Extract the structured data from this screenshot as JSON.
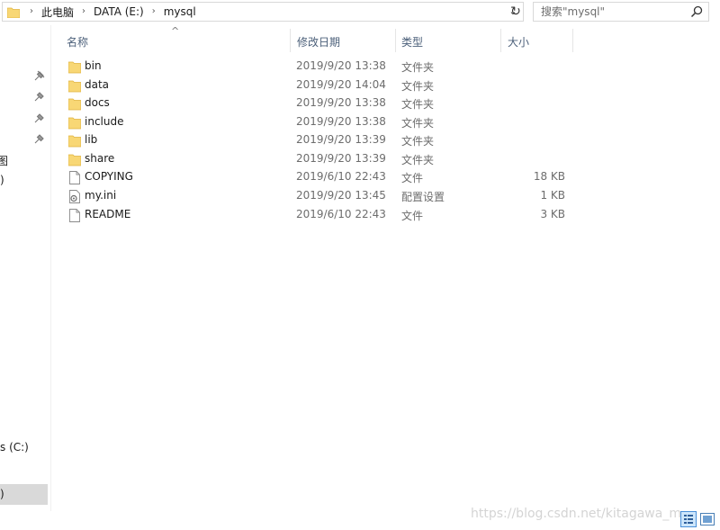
{
  "address_bar": {
    "breadcrumbs": [
      "此电脑",
      "DATA (E:)",
      "mysql"
    ]
  },
  "search": {
    "placeholder": "搜索\"mysql\""
  },
  "nav_pane": {
    "fragments": [
      "图",
      ")",
      "s (C:)",
      ")"
    ]
  },
  "columns": {
    "name": "名称",
    "date": "修改日期",
    "type": "类型",
    "size": "大小"
  },
  "files": [
    {
      "name": "bin",
      "date": "2019/9/20 13:38",
      "type": "文件夹",
      "size": "",
      "icon": "folder-icon"
    },
    {
      "name": "data",
      "date": "2019/9/20 14:04",
      "type": "文件夹",
      "size": "",
      "icon": "folder-icon"
    },
    {
      "name": "docs",
      "date": "2019/9/20 13:38",
      "type": "文件夹",
      "size": "",
      "icon": "folder-icon"
    },
    {
      "name": "include",
      "date": "2019/9/20 13:38",
      "type": "文件夹",
      "size": "",
      "icon": "folder-icon"
    },
    {
      "name": "lib",
      "date": "2019/9/20 13:39",
      "type": "文件夹",
      "size": "",
      "icon": "folder-icon"
    },
    {
      "name": "share",
      "date": "2019/9/20 13:39",
      "type": "文件夹",
      "size": "",
      "icon": "folder-icon"
    },
    {
      "name": "COPYING",
      "date": "2019/6/10 22:43",
      "type": "文件",
      "size": "18 KB",
      "icon": "file-icon"
    },
    {
      "name": "my.ini",
      "date": "2019/9/20 13:45",
      "type": "配置设置",
      "size": "1 KB",
      "icon": "config-file-icon"
    },
    {
      "name": "README",
      "date": "2019/6/10 22:43",
      "type": "文件",
      "size": "3 KB",
      "icon": "file-icon"
    }
  ],
  "watermark": "https://blog.csdn.net/kitagawa_m",
  "colors": {
    "folder": "#f8d775",
    "folder_dark": "#e0b33d",
    "header_text": "#4c607a",
    "secondary_text": "#6d6d6d",
    "selection": "#d9d9d9"
  }
}
